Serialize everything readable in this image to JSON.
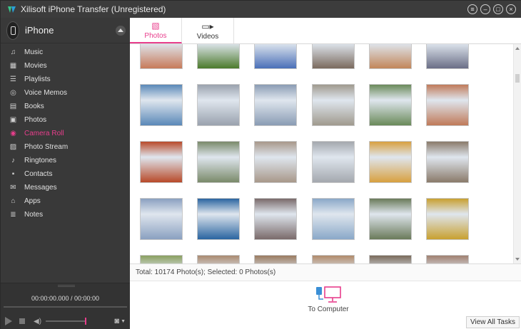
{
  "window": {
    "title": "Xilisoft iPhone Transfer (Unregistered)"
  },
  "device": {
    "name": "iPhone"
  },
  "sidebar": {
    "items": [
      {
        "label": "Music",
        "icon": "music-icon",
        "glyph": "♫"
      },
      {
        "label": "Movies",
        "icon": "movies-icon",
        "glyph": "▦"
      },
      {
        "label": "Playlists",
        "icon": "playlists-icon",
        "glyph": "☰"
      },
      {
        "label": "Voice Memos",
        "icon": "microphone-icon",
        "glyph": "◎"
      },
      {
        "label": "Books",
        "icon": "books-icon",
        "glyph": "▤"
      },
      {
        "label": "Photos",
        "icon": "photos-icon",
        "glyph": "▣"
      },
      {
        "label": "Camera Roll",
        "icon": "camera-icon",
        "glyph": "◉",
        "active": true
      },
      {
        "label": "Photo Stream",
        "icon": "photo-stream-icon",
        "glyph": "▨"
      },
      {
        "label": "Ringtones",
        "icon": "ringtones-icon",
        "glyph": "♪"
      },
      {
        "label": "Contacts",
        "icon": "contacts-icon",
        "glyph": "▪"
      },
      {
        "label": "Messages",
        "icon": "messages-icon",
        "glyph": "✉"
      },
      {
        "label": "Apps",
        "icon": "apps-icon",
        "glyph": "⌂"
      },
      {
        "label": "Notes",
        "icon": "notes-icon",
        "glyph": "≣"
      }
    ]
  },
  "player": {
    "time": "00:00:00.000 / 00:00:00"
  },
  "tabs": [
    {
      "label": "Photos",
      "icon": "photo-icon",
      "active": true
    },
    {
      "label": "Videos",
      "icon": "video-icon",
      "active": false
    }
  ],
  "gallery": {
    "rows": [
      [
        "#c77a5a",
        "#4c7a2c",
        "#4a6fb8",
        "#7a6a5e",
        "#c2865a",
        "#6a6e86"
      ],
      [
        "#5a88b8",
        "#9aa2ae",
        "#8a9cb4",
        "#a09a8e",
        "#6a8a5a",
        "#c07a5a"
      ],
      [
        "#b84a2a",
        "#7a8a6a",
        "#a8988a",
        "#a4a8ae",
        "#d8a040",
        "#8a7a6a"
      ],
      [
        "#8aa0c0",
        "#2a64a0",
        "#7a6a6a",
        "#8aa8c8",
        "#6a7a5a",
        "#c8a030"
      ],
      [
        "#8aa060",
        "#aa8a70",
        "#9a7a60",
        "#b08a6a",
        "#7a6a5a",
        "#a08070"
      ]
    ]
  },
  "status": {
    "text": "Total: 10174 Photo(s); Selected: 0 Photos(s)"
  },
  "actions": {
    "to_computer": "To Computer",
    "view_all": "View All Tasks"
  },
  "colors": {
    "accent": "#e83e8c",
    "sidebar_bg": "#393939",
    "title_bg": "#3c3c3c"
  }
}
